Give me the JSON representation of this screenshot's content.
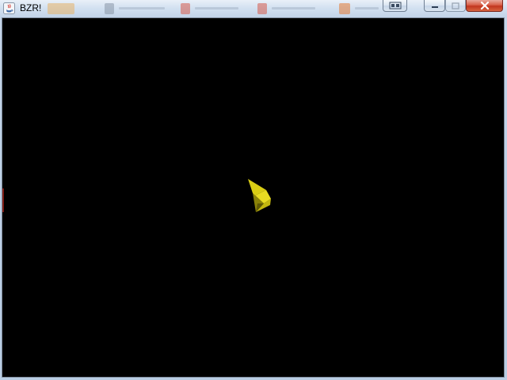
{
  "window": {
    "title": "BZR!",
    "app_icon": "java-coffee-cup-icon",
    "controls": {
      "extra": "window-switch-icon",
      "minimize": "minimize-icon",
      "maximize": "maximize-icon",
      "close": "close-icon"
    }
  },
  "scene": {
    "background_color": "#000000",
    "object_color": "#e6d81a",
    "object": "yellow-arrow-ship"
  }
}
